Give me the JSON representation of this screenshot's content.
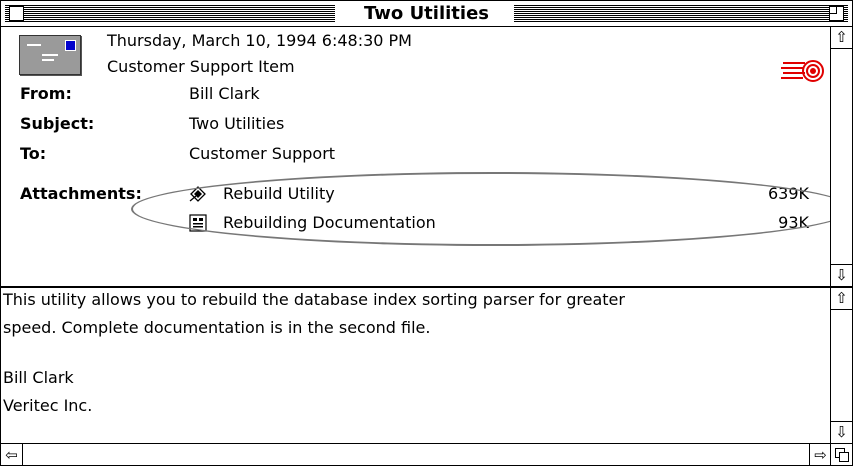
{
  "window": {
    "title": "Two Utilities"
  },
  "message": {
    "date": "Thursday, March 10, 1994 6:48:30 PM",
    "category": "Customer Support Item",
    "from_label": "From:",
    "from": "Bill Clark",
    "subject_label": "Subject:",
    "subject": "Two Utilities",
    "to_label": "To:",
    "to": "Customer Support",
    "attachments_label": "Attachments:",
    "attachments": [
      {
        "name": "Rebuild Utility",
        "size": "639K",
        "icon": "application-icon"
      },
      {
        "name": "Rebuilding Documentation",
        "size": "93K",
        "icon": "document-icon"
      }
    ]
  },
  "body": {
    "line1": "This utility allows you to rebuild the database index sorting parser for greater",
    "line2": "speed. Complete documentation is in the second file.",
    "line3": "Bill Clark",
    "line4": "Veritec Inc."
  },
  "colors": {
    "envelope": "#9a9a9a",
    "stamp": "#0000cc",
    "flag": "#e00000",
    "oval": "#777777"
  },
  "icons": {
    "close": "close-box-icon",
    "zoom": "zoom-box-icon",
    "priority": "priority-flag-icon"
  }
}
